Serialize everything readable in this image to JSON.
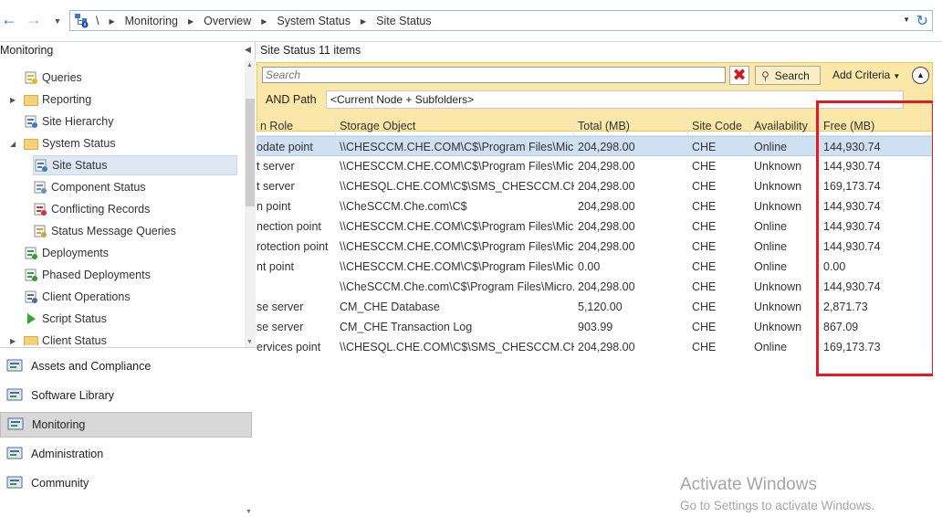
{
  "address_bar": {
    "breadcrumbs": [
      "\\",
      "Monitoring",
      "Overview",
      "System Status",
      "Site Status"
    ]
  },
  "navigation": {
    "workspace_title": "Monitoring",
    "tree_items": [
      {
        "label": "Queries",
        "icon": "queries-icon",
        "indent": 1,
        "expander": ""
      },
      {
        "label": "Reporting",
        "icon": "folder-icon",
        "indent": 1,
        "expander": "collapsed"
      },
      {
        "label": "Site Hierarchy",
        "icon": "hierarchy-icon",
        "indent": 1,
        "expander": ""
      },
      {
        "label": "System Status",
        "icon": "folder-icon",
        "indent": 1,
        "expander": "expanded"
      },
      {
        "label": "Site Status",
        "icon": "site-status-icon",
        "indent": 2,
        "expander": "",
        "selected": true
      },
      {
        "label": "Component Status",
        "icon": "component-status-icon",
        "indent": 2,
        "expander": ""
      },
      {
        "label": "Conflicting Records",
        "icon": "conflicting-records-icon",
        "indent": 2,
        "expander": ""
      },
      {
        "label": "Status Message Queries",
        "icon": "status-message-icon",
        "indent": 2,
        "expander": ""
      },
      {
        "label": "Deployments",
        "icon": "deployments-icon",
        "indent": 1,
        "expander": ""
      },
      {
        "label": "Phased Deployments",
        "icon": "phased-deployments-icon",
        "indent": 1,
        "expander": ""
      },
      {
        "label": "Client Operations",
        "icon": "client-operations-icon",
        "indent": 1,
        "expander": ""
      },
      {
        "label": "Script Status",
        "icon": "script-status-icon",
        "indent": 1,
        "expander": ""
      },
      {
        "label": "Client Status",
        "icon": "folder-icon",
        "indent": 1,
        "expander": "collapsed"
      }
    ],
    "workspaces": [
      {
        "label": "Assets and Compliance",
        "icon": "assets-compliance-icon"
      },
      {
        "label": "Software Library",
        "icon": "software-library-icon"
      },
      {
        "label": "Monitoring",
        "icon": "monitoring-icon",
        "active": true
      },
      {
        "label": "Administration",
        "icon": "administration-icon"
      },
      {
        "label": "Community",
        "icon": "community-icon"
      }
    ]
  },
  "list": {
    "title": "Site Status",
    "item_count": "11 items",
    "search_placeholder": "Search",
    "search_button": "Search",
    "add_criteria": "Add Criteria",
    "and_path_label": "AND Path",
    "path_value": "<Current Node + Subfolders>",
    "columns": [
      "n Role",
      "Storage Object",
      "Total (MB)",
      "Site Code",
      "Availability",
      "Free (MB)"
    ],
    "rows": [
      {
        "role": "odate point",
        "storage": "\\\\CHESCCM.CHE.COM\\C$\\Program Files\\Micr...",
        "total": "204,298.00",
        "site": "CHE",
        "availability": "Online",
        "free": "144,930.74",
        "selected": true
      },
      {
        "role": "t server",
        "storage": "\\\\CHESCCM.CHE.COM\\C$\\Program Files\\Micr...",
        "total": "204,298.00",
        "site": "CHE",
        "availability": "Unknown",
        "free": "144,930.74"
      },
      {
        "role": "t server",
        "storage": "\\\\CHESQL.CHE.COM\\C$\\SMS_CHESCCM.CHE....",
        "total": "204,298.00",
        "site": "CHE",
        "availability": "Unknown",
        "free": "169,173.74"
      },
      {
        "role": "n point",
        "storage": "\\\\CheSCCM.Che.com\\C$",
        "total": "204,298.00",
        "site": "CHE",
        "availability": "Unknown",
        "free": "144,930.74"
      },
      {
        "role": "nection point",
        "storage": "\\\\CHESCCM.CHE.COM\\C$\\Program Files\\Micr...",
        "total": "204,298.00",
        "site": "CHE",
        "availability": "Online",
        "free": "144,930.74"
      },
      {
        "role": "rotection point",
        "storage": "\\\\CHESCCM.CHE.COM\\C$\\Program Files\\Micr...",
        "total": "204,298.00",
        "site": "CHE",
        "availability": "Online",
        "free": "144,930.74"
      },
      {
        "role": "nt point",
        "storage": "\\\\CHESCCM.CHE.COM\\C$\\Program Files\\Micr...",
        "total": "0.00",
        "site": "CHE",
        "availability": "Online",
        "free": "0.00"
      },
      {
        "role": "",
        "storage": "\\\\CheSCCM.Che.com\\C$\\Program Files\\Micro...",
        "total": "204,298.00",
        "site": "CHE",
        "availability": "Unknown",
        "free": "144,930.74"
      },
      {
        "role": "se server",
        "storage": "CM_CHE Database",
        "total": "5,120.00",
        "site": "CHE",
        "availability": "Unknown",
        "free": "2,871.73"
      },
      {
        "role": "se server",
        "storage": "CM_CHE Transaction Log",
        "total": "903.99",
        "site": "CHE",
        "availability": "Unknown",
        "free": "867.09"
      },
      {
        "role": "ervices point",
        "storage": "\\\\CHESQL.CHE.COM\\C$\\SMS_CHESCCM.CHE....",
        "total": "204,298.00",
        "site": "CHE",
        "availability": "Online",
        "free": "169,173.73"
      }
    ]
  },
  "watermark": {
    "line1": "Activate Windows",
    "line2": "Go to Settings to activate Windows."
  },
  "colors": {
    "highlight_box": "#e21a24",
    "search_bar_bg": "#fbe7a8",
    "selection_bg": "#cfe0f2"
  }
}
